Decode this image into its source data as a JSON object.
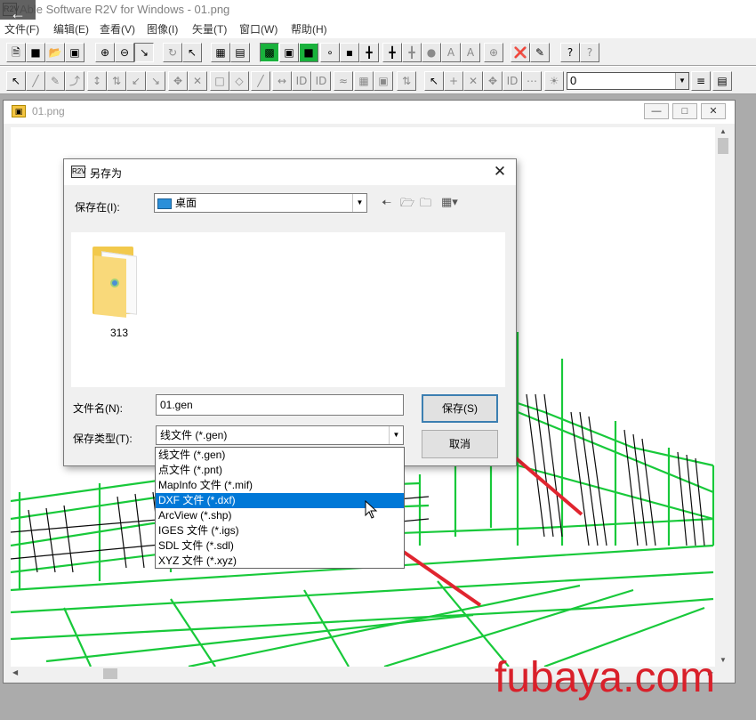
{
  "app": {
    "title": "Able Software R2V for Windows - 01.png"
  },
  "menu": [
    "文件(F)",
    "编辑(E)",
    "查看(V)",
    "图像(I)",
    "矢量(T)",
    "窗口(W)",
    "帮助(H)"
  ],
  "toolbar2": {
    "combo_value": "0"
  },
  "document": {
    "name": "01.png"
  },
  "dialog": {
    "title": "另存为",
    "save_in_label": "保存在(I):",
    "save_in_value": "桌面",
    "files": [
      {
        "name": "313",
        "type": "folder"
      }
    ],
    "filename_label": "文件名(N):",
    "filename_value": "01.gen",
    "filetype_label": "保存类型(T):",
    "filetype_value": "线文件 (*.gen)",
    "save_button": "保存(S)",
    "cancel_button": "取消"
  },
  "filetype_options": [
    "线文件 (*.gen)",
    "点文件 (*.pnt)",
    "MapInfo 文件 (*.mif)",
    "DXF 文件 (*.dxf)",
    "ArcView (*.shp)",
    "IGES 文件 (*.igs)",
    "SDL 文件 (*.sdl)",
    "XYZ 文件 (*.xyz)"
  ],
  "selected_filetype_index": 3,
  "watermark": "fubaya.com",
  "colors": {
    "accent": "#0078d7",
    "arrow": "#e0252f",
    "vector_lines": "#18c93a",
    "watermark": "#d9202a"
  }
}
